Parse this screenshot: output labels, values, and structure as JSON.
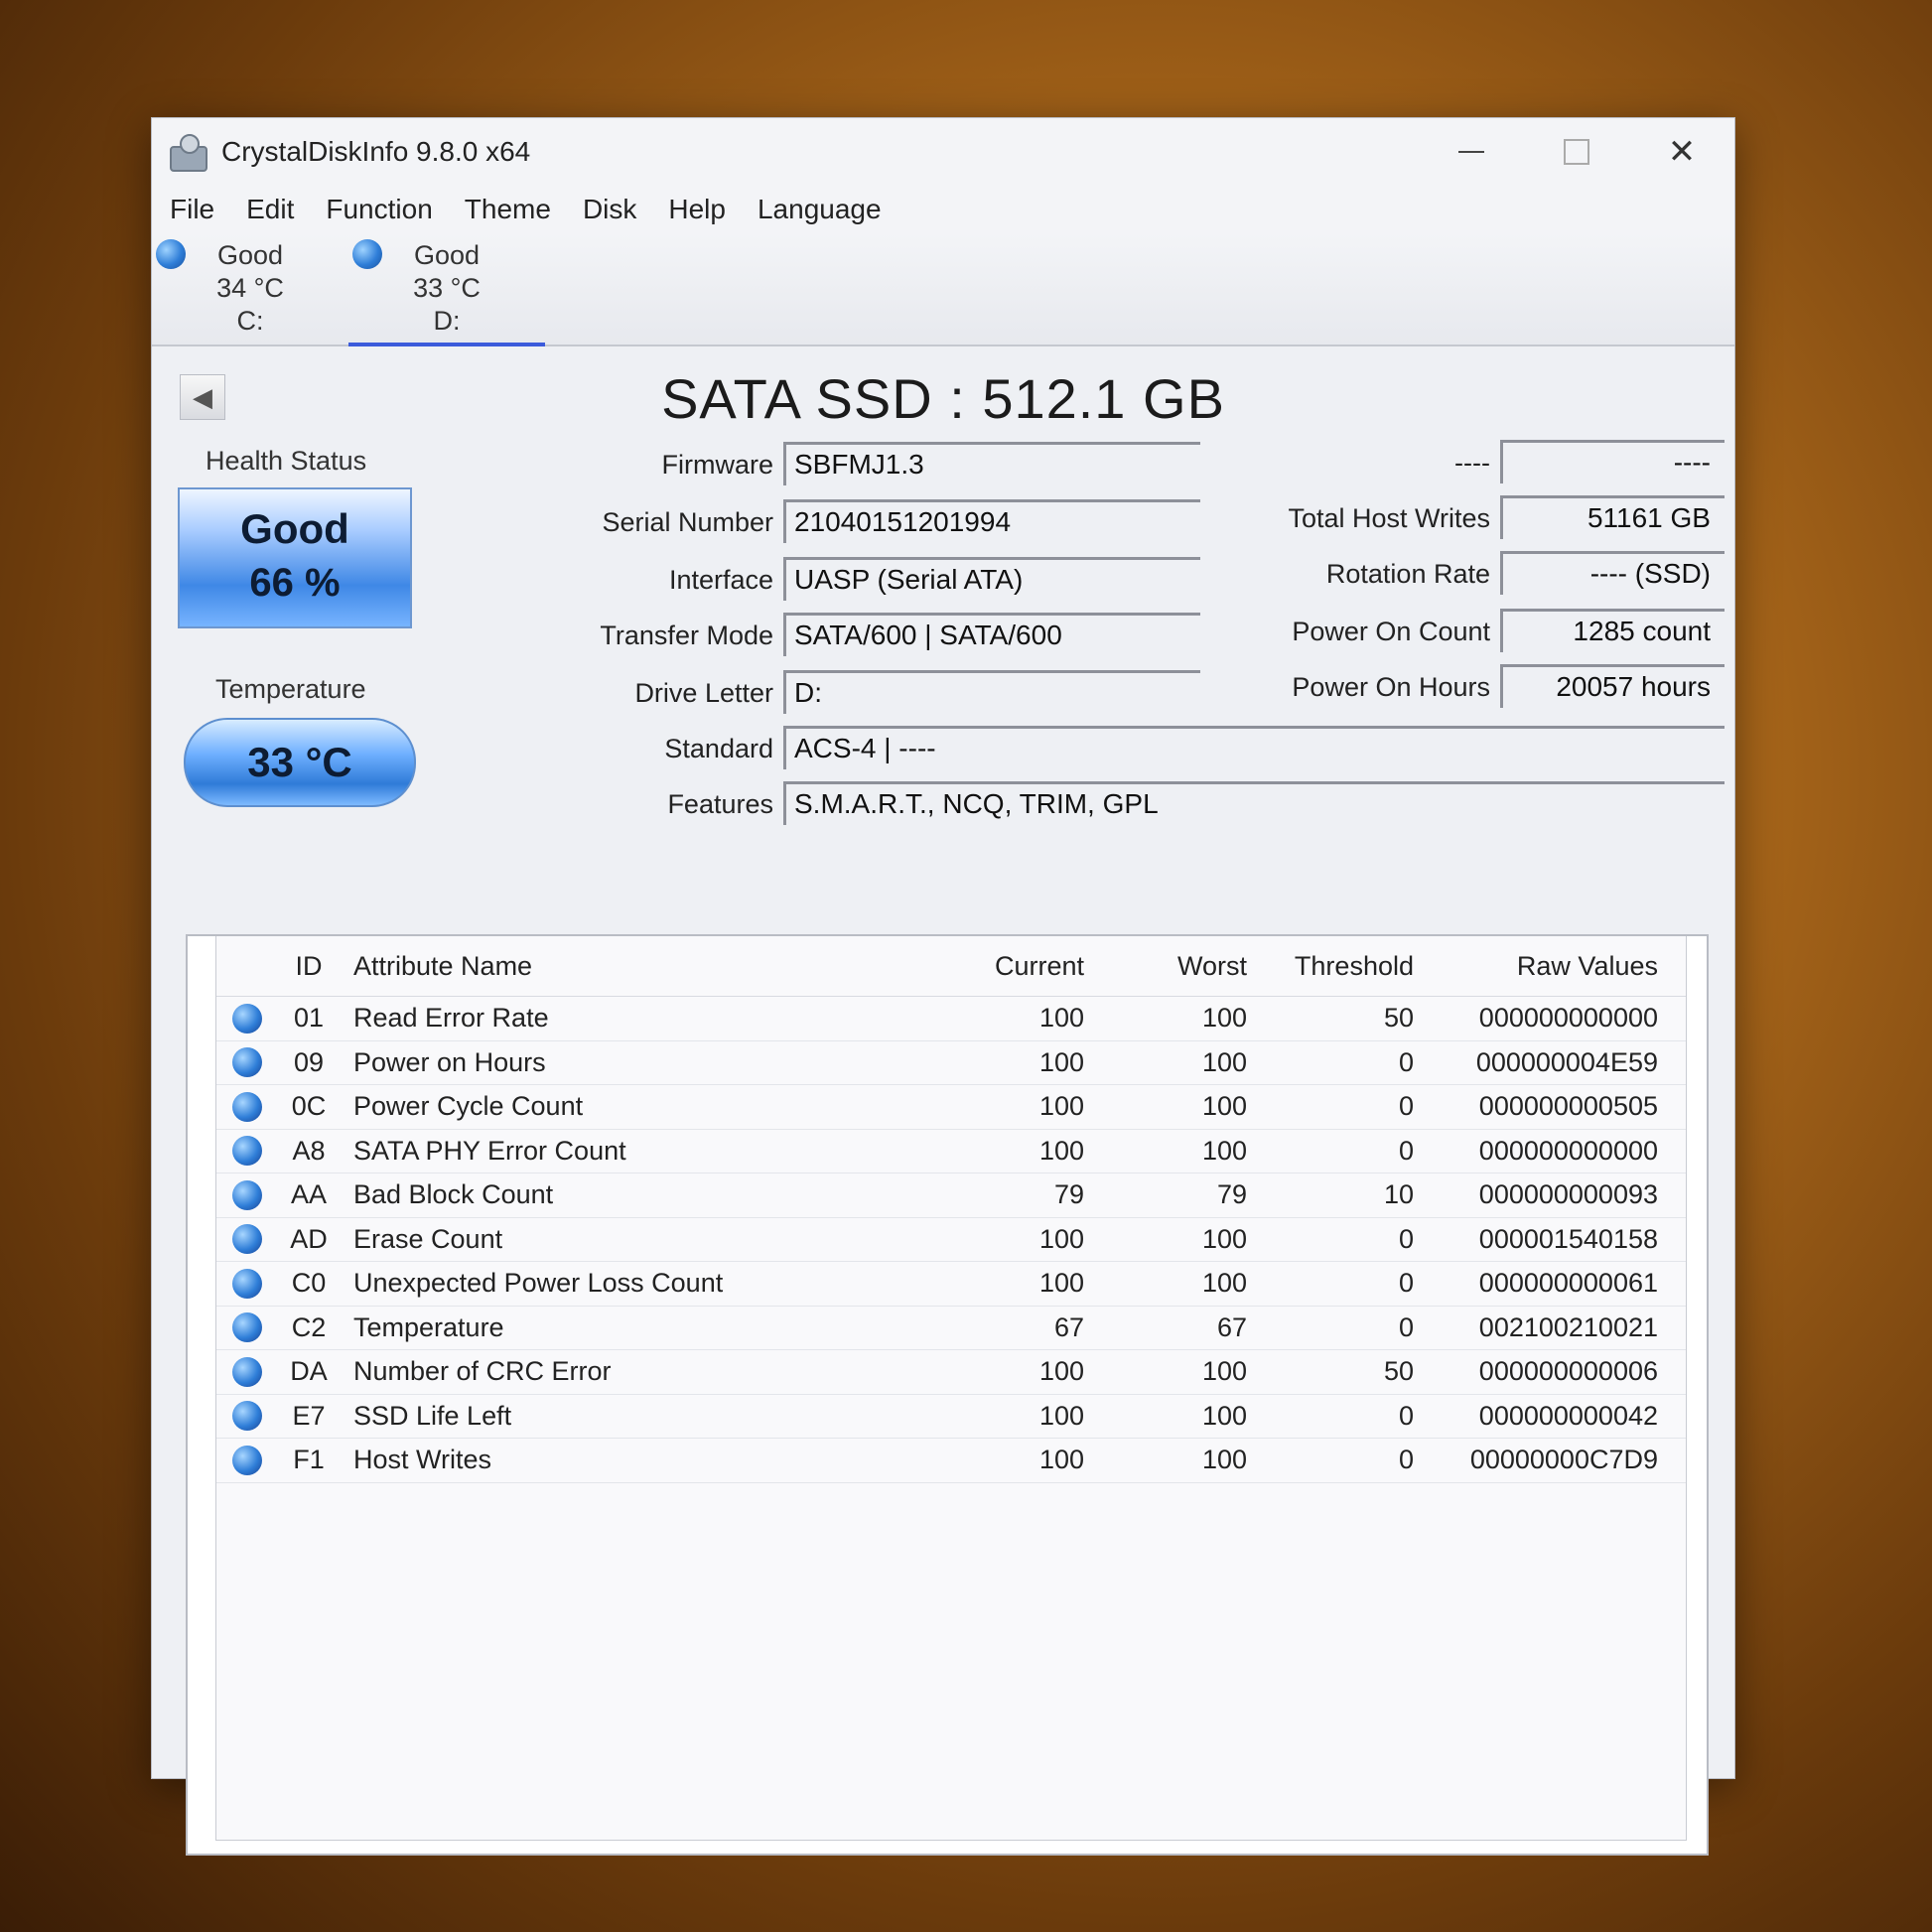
{
  "window": {
    "title": "CrystalDiskInfo 9.8.0 x64",
    "close_glyph": "✕"
  },
  "menu": [
    "File",
    "Edit",
    "Function",
    "Theme",
    "Disk",
    "Help",
    "Language"
  ],
  "disks": [
    {
      "status": "Good",
      "temp": "34 °C",
      "letter": "C:"
    },
    {
      "status": "Good",
      "temp": "33 °C",
      "letter": "D:"
    }
  ],
  "prev_glyph": "◀",
  "model": "SATA SSD : 512.1 GB",
  "health": {
    "label": "Health Status",
    "status": "Good",
    "percent": "66 %"
  },
  "temperature": {
    "label": "Temperature",
    "value": "33 °C"
  },
  "fields": {
    "firmware": {
      "label": "Firmware",
      "value": "SBFMJ1.3"
    },
    "serial": {
      "label": "Serial Number",
      "value": "21040151201994"
    },
    "interface": {
      "label": "Interface",
      "value": "UASP (Serial ATA)"
    },
    "transfer": {
      "label": "Transfer Mode",
      "value": "SATA/600 | SATA/600"
    },
    "drive_letter": {
      "label": "Drive Letter",
      "value": "D:"
    },
    "standard": {
      "label": "Standard",
      "value": "ACS-4 | ----"
    },
    "features": {
      "label": "Features",
      "value": "S.M.A.R.T., NCQ, TRIM, GPL"
    },
    "unknown": {
      "label": "----",
      "value": "----"
    },
    "host_writes": {
      "label": "Total Host Writes",
      "value": "51161 GB"
    },
    "rotation": {
      "label": "Rotation Rate",
      "value": "---- (SSD)"
    },
    "power_count": {
      "label": "Power On Count",
      "value": "1285 count"
    },
    "power_hours": {
      "label": "Power On Hours",
      "value": "20057 hours"
    }
  },
  "smart": {
    "headers": {
      "id": "ID",
      "name": "Attribute Name",
      "current": "Current",
      "worst": "Worst",
      "threshold": "Threshold",
      "raw": "Raw Values"
    },
    "rows": [
      {
        "id": "01",
        "name": "Read Error Rate",
        "current": "100",
        "worst": "100",
        "threshold": "50",
        "raw": "000000000000"
      },
      {
        "id": "09",
        "name": "Power on Hours",
        "current": "100",
        "worst": "100",
        "threshold": "0",
        "raw": "000000004E59"
      },
      {
        "id": "0C",
        "name": "Power Cycle Count",
        "current": "100",
        "worst": "100",
        "threshold": "0",
        "raw": "000000000505"
      },
      {
        "id": "A8",
        "name": "SATA PHY Error Count",
        "current": "100",
        "worst": "100",
        "threshold": "0",
        "raw": "000000000000"
      },
      {
        "id": "AA",
        "name": "Bad Block Count",
        "current": "79",
        "worst": "79",
        "threshold": "10",
        "raw": "000000000093"
      },
      {
        "id": "AD",
        "name": "Erase Count",
        "current": "100",
        "worst": "100",
        "threshold": "0",
        "raw": "000001540158"
      },
      {
        "id": "C0",
        "name": "Unexpected Power Loss Count",
        "current": "100",
        "worst": "100",
        "threshold": "0",
        "raw": "000000000061"
      },
      {
        "id": "C2",
        "name": "Temperature",
        "current": "67",
        "worst": "67",
        "threshold": "0",
        "raw": "002100210021"
      },
      {
        "id": "DA",
        "name": "Number of CRC Error",
        "current": "100",
        "worst": "100",
        "threshold": "50",
        "raw": "000000000006"
      },
      {
        "id": "E7",
        "name": "SSD Life Left",
        "current": "100",
        "worst": "100",
        "threshold": "0",
        "raw": "000000000042"
      },
      {
        "id": "F1",
        "name": "Host Writes",
        "current": "100",
        "worst": "100",
        "threshold": "0",
        "raw": "00000000C7D9"
      }
    ]
  },
  "colors": {
    "status_good": "#2f7ed8",
    "accent_tab": "#3b5bdb"
  }
}
